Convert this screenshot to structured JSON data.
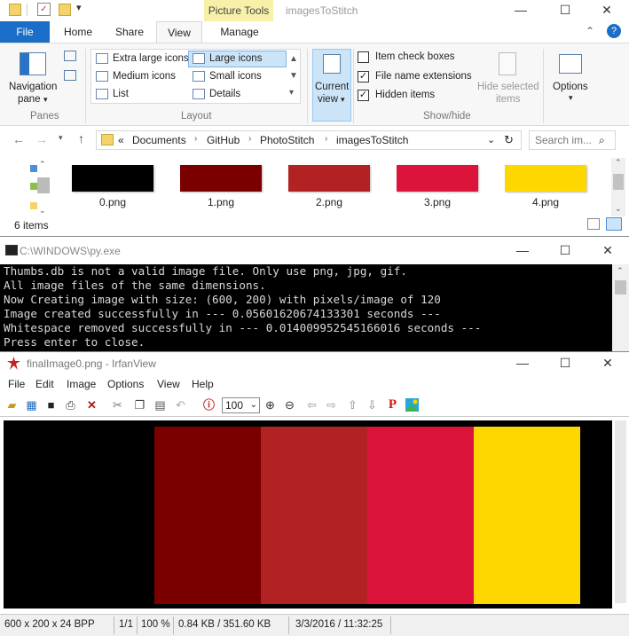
{
  "explorer": {
    "title": "imagesToStitch",
    "contextual_tab": "Picture Tools",
    "tabs": {
      "file": "File",
      "home": "Home",
      "share": "Share",
      "view": "View",
      "manage": "Manage"
    },
    "panes": {
      "nav_pane_line1": "Navigation",
      "nav_pane_line2": "pane",
      "group": "Panes"
    },
    "layout": {
      "extra_large": "Extra large icons",
      "large": "Large icons",
      "medium": "Medium icons",
      "small": "Small icons",
      "list": "List",
      "details": "Details",
      "group": "Layout"
    },
    "current_view": {
      "line1": "Current",
      "line2": "view"
    },
    "show_hide": {
      "item_checkboxes": "Item check boxes",
      "file_name_extensions": "File name extensions",
      "hidden_items": "Hidden items",
      "hide_selected_line1": "Hide selected",
      "hide_selected_line2": "items",
      "group": "Show/hide"
    },
    "options": "Options",
    "breadcrumb": [
      "Documents",
      "GitHub",
      "PhotoStitch",
      "imagesToStitch"
    ],
    "breadcrumb_prefix": "«",
    "search_placeholder": "Search im...",
    "files": [
      {
        "name": "0.png",
        "color": "#000000"
      },
      {
        "name": "1.png",
        "color": "#7a0000"
      },
      {
        "name": "2.png",
        "color": "#b22222"
      },
      {
        "name": "3.png",
        "color": "#dc143c"
      },
      {
        "name": "4.png",
        "color": "#ffd700"
      }
    ],
    "status": "6 items"
  },
  "console": {
    "title": "C:\\WINDOWS\\py.exe",
    "lines": [
      "Thumbs.db is not a valid image file. Only use png, jpg, gif.",
      "All image files of the same dimensions.",
      "Now Creating image with size: (600, 200) with pixels/image of 120",
      "Image created successfully in --- 0.05601620674133301 seconds ---",
      "Whitespace removed successfully in --- 0.014009952545166016 seconds ---",
      "Press enter to close."
    ]
  },
  "irfan": {
    "title": "finalImage0.png - IrfanView",
    "menu": [
      "File",
      "Edit",
      "Image",
      "Options",
      "View",
      "Help"
    ],
    "zoom": "100",
    "stripes": [
      "#7a0000",
      "#b22222",
      "#dc143c",
      "#ffd700"
    ],
    "status": {
      "dimensions": "600 x 200 x 24 BPP",
      "page": "1/1",
      "zoom": "100 %",
      "size": "0.84 KB / 351.60 KB",
      "datetime": "3/3/2016 / 11:32:25"
    }
  }
}
